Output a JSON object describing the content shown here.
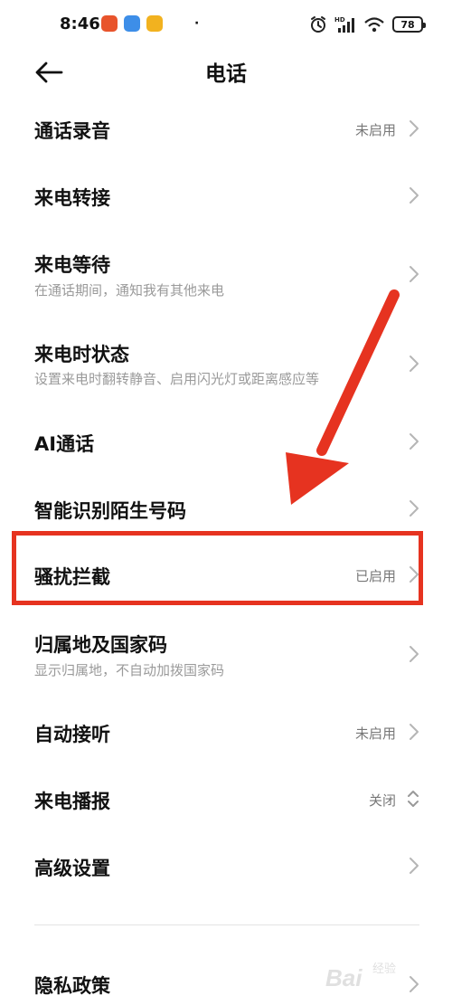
{
  "status_bar": {
    "time": "8:46",
    "dot": "·",
    "battery": "78",
    "app_icons": [
      "orange-app-icon",
      "blue-app-icon",
      "yellow-app-icon"
    ],
    "indicators": [
      "alarm-icon",
      "hd-signal-icon",
      "wifi-icon"
    ]
  },
  "header": {
    "title": "电话",
    "back_icon": "back-arrow-icon"
  },
  "settings": {
    "call_recording": {
      "title": "通话录音",
      "value": "未启用"
    },
    "call_forwarding": {
      "title": "来电转接"
    },
    "call_waiting": {
      "title": "来电等待",
      "subtitle": "在通话期间，通知我有其他来电"
    },
    "incoming_call_status": {
      "title": "来电时状态",
      "subtitle": "设置来电时翻转静音、启用闪光灯或距离感应等"
    },
    "ai_call": {
      "title": "AI通话"
    },
    "smart_identify": {
      "title": "智能识别陌生号码"
    },
    "harassment_block": {
      "title": "骚扰拦截",
      "value": "已启用"
    },
    "location_code": {
      "title": "归属地及国家码",
      "subtitle": "显示归属地，不自动加拨国家码"
    },
    "auto_answer": {
      "title": "自动接听",
      "value": "未启用"
    },
    "caller_announce": {
      "title": "来电播报",
      "value": "关闭"
    },
    "advanced": {
      "title": "高级设置"
    },
    "privacy_policy": {
      "title": "隐私政策"
    }
  },
  "annotation": {
    "highlight_color": "#e63320"
  },
  "watermark": {
    "text": "Bai",
    "sub": "经验"
  }
}
